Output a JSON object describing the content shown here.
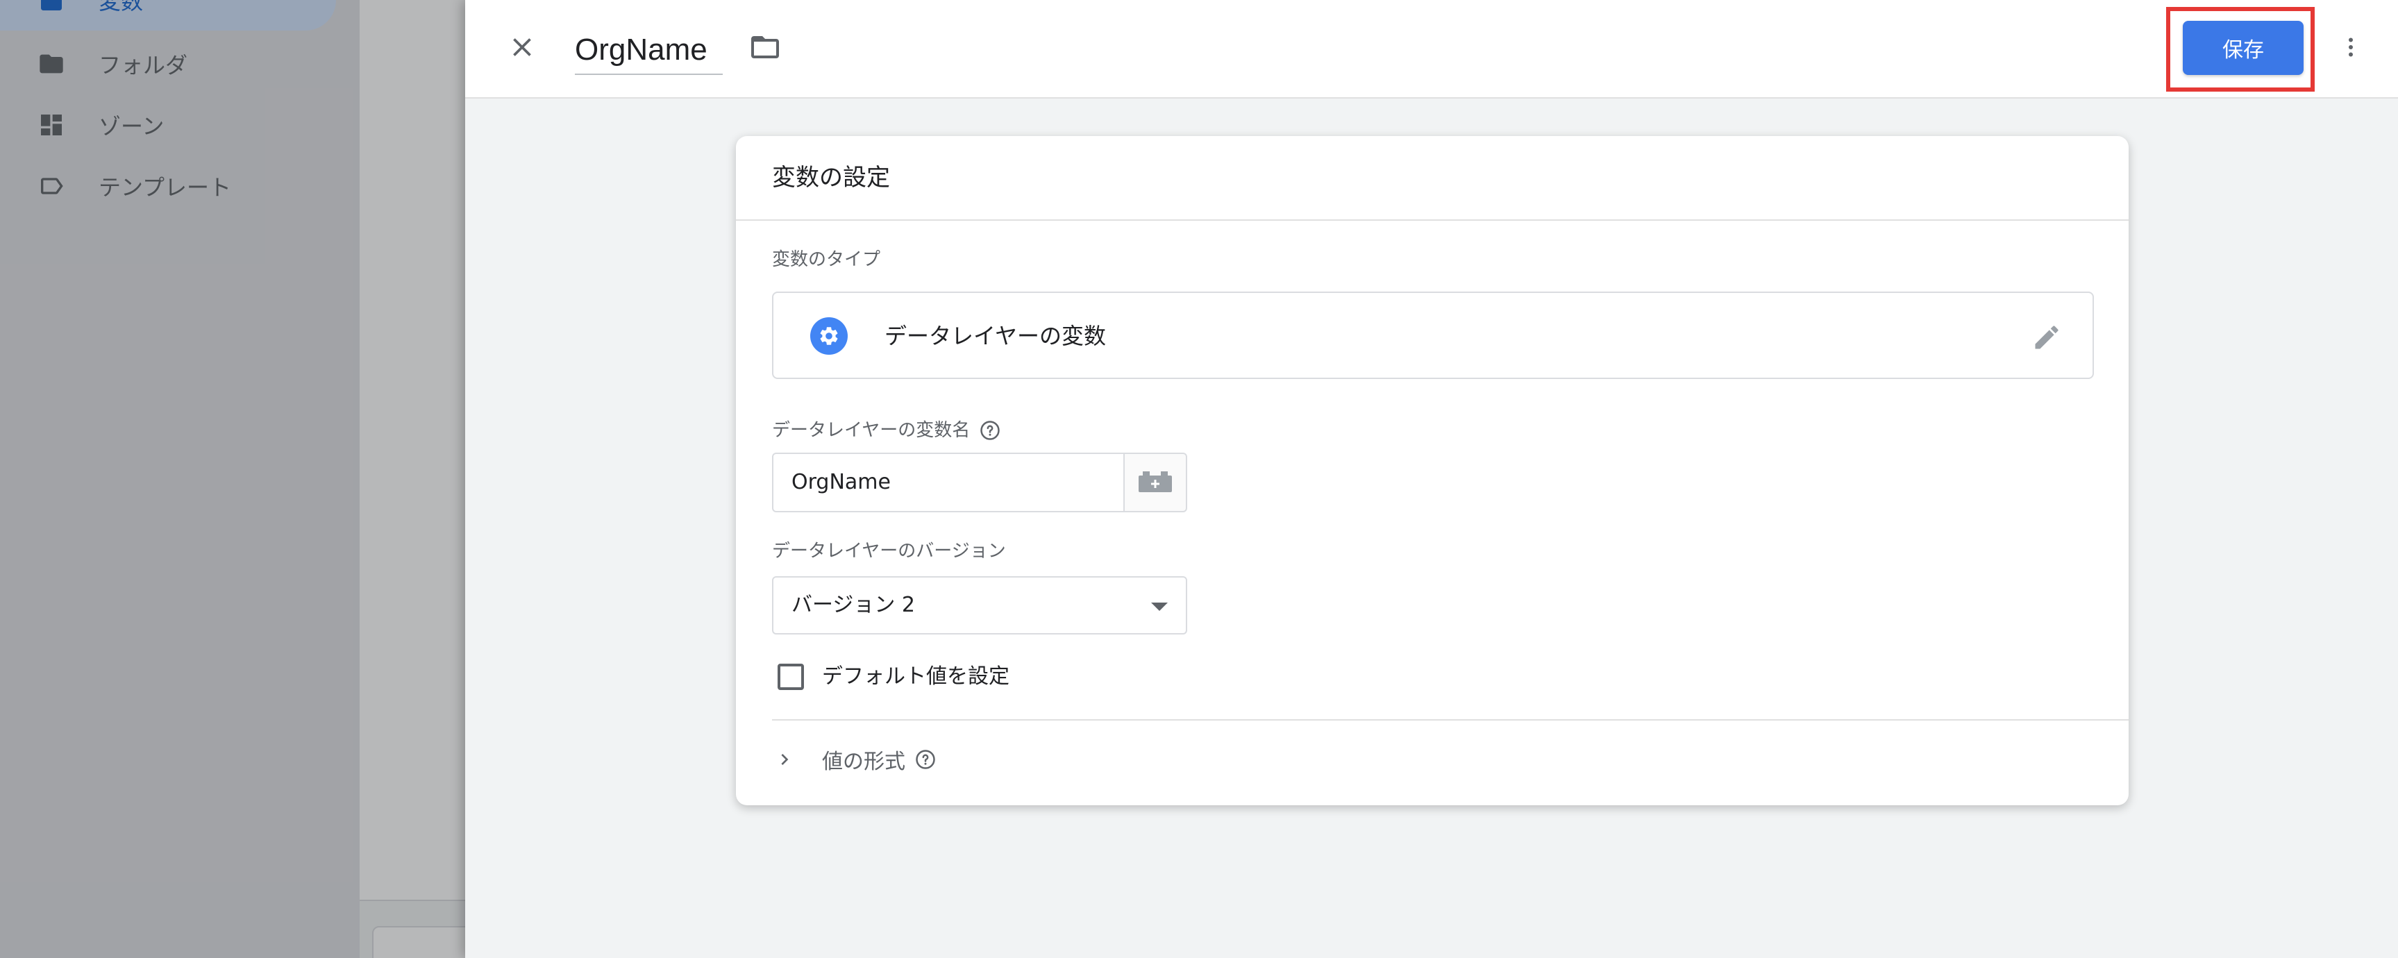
{
  "background": {
    "sidebar": {
      "items": [
        {
          "label": "変数",
          "icon": "variable-icon",
          "active": true
        },
        {
          "label": "フォルダ",
          "icon": "folder-icon"
        },
        {
          "label": "ゾーン",
          "icon": "zones-icon"
        },
        {
          "label": "テンプレート",
          "icon": "label-icon"
        }
      ]
    }
  },
  "header": {
    "title": "OrgName",
    "save_label": "保存",
    "close_icon": "close-icon",
    "folder_icon": "folder-icon",
    "more_icon": "more-vert-icon"
  },
  "card": {
    "title": "変数の設定",
    "type_section_label": "変数のタイプ",
    "type_name": "データレイヤーの変数",
    "type_icon": "gear-icon",
    "name_label": "データレイヤーの変数名",
    "name_value": "OrgName",
    "version_label": "データレイヤーのバージョン",
    "version_value": "バージョン 2",
    "default_checkbox_label": "デフォルト値を設定",
    "default_checked": false,
    "format_label": "値の形式"
  },
  "colors": {
    "primary": "#3b78e7",
    "highlight": "#e53935",
    "active_nav_bg": "#d2e3fc"
  }
}
